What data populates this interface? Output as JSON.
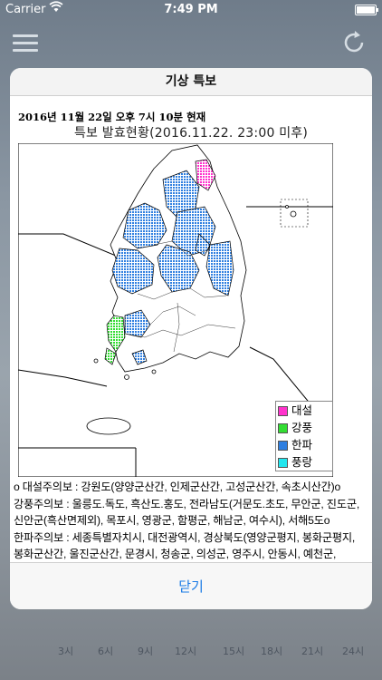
{
  "status_bar": {
    "carrier": "Carrier",
    "time": "7:49 PM"
  },
  "background": {
    "axis_labels": [
      "3시",
      "6시",
      "9시",
      "12시",
      "15시",
      "18시",
      "21시",
      "24시"
    ]
  },
  "dialog": {
    "title": "기상 특보",
    "report_time": "2016년 11월 22일 오후 7시 10분 현재",
    "map_title": "특보 발효현황(2016.11.22. 23:00 미후)",
    "legend": [
      {
        "label": "대설",
        "color": "#ff33cc"
      },
      {
        "label": "강풍",
        "color": "#33dd33"
      },
      {
        "label": "한파",
        "color": "#2f7fe0"
      },
      {
        "label": "풍랑",
        "color": "#22e6ee"
      }
    ],
    "description": "o 대설주의보 : 강원도(양양군산간, 인제군산간, 고성군산간, 속초시산간)o 강풍주의보 : 울릉도.독도, 흑산도.홍도, 전라남도(거문도.초도, 무안군, 진도군, 신안군(흑산면제외), 목포시, 영광군, 함평군, 해남군, 여수시), 서해5도o 한파주의보 : 세종특별자치시, 대전광역시, 경상북도(영양군평지, 봉화군평지, 봉화군산간, 울진군산간, 문경시, 청송군, 의성군, 영주시, 안동시, 예천군, 상주시, 영양군산간), 전라남도(화순군, 나주시, 순천시, 보성군, 장성군, 구례군, 곡성군, 담양군), 충청북도, 충청남도(계룡시, 청양군, 부여군, 금산군, 논산시, 공주시, 천안시), 강원도(평창군평지, 홍천군평지, 횡성군, 춘천",
    "close_label": "닫기"
  }
}
